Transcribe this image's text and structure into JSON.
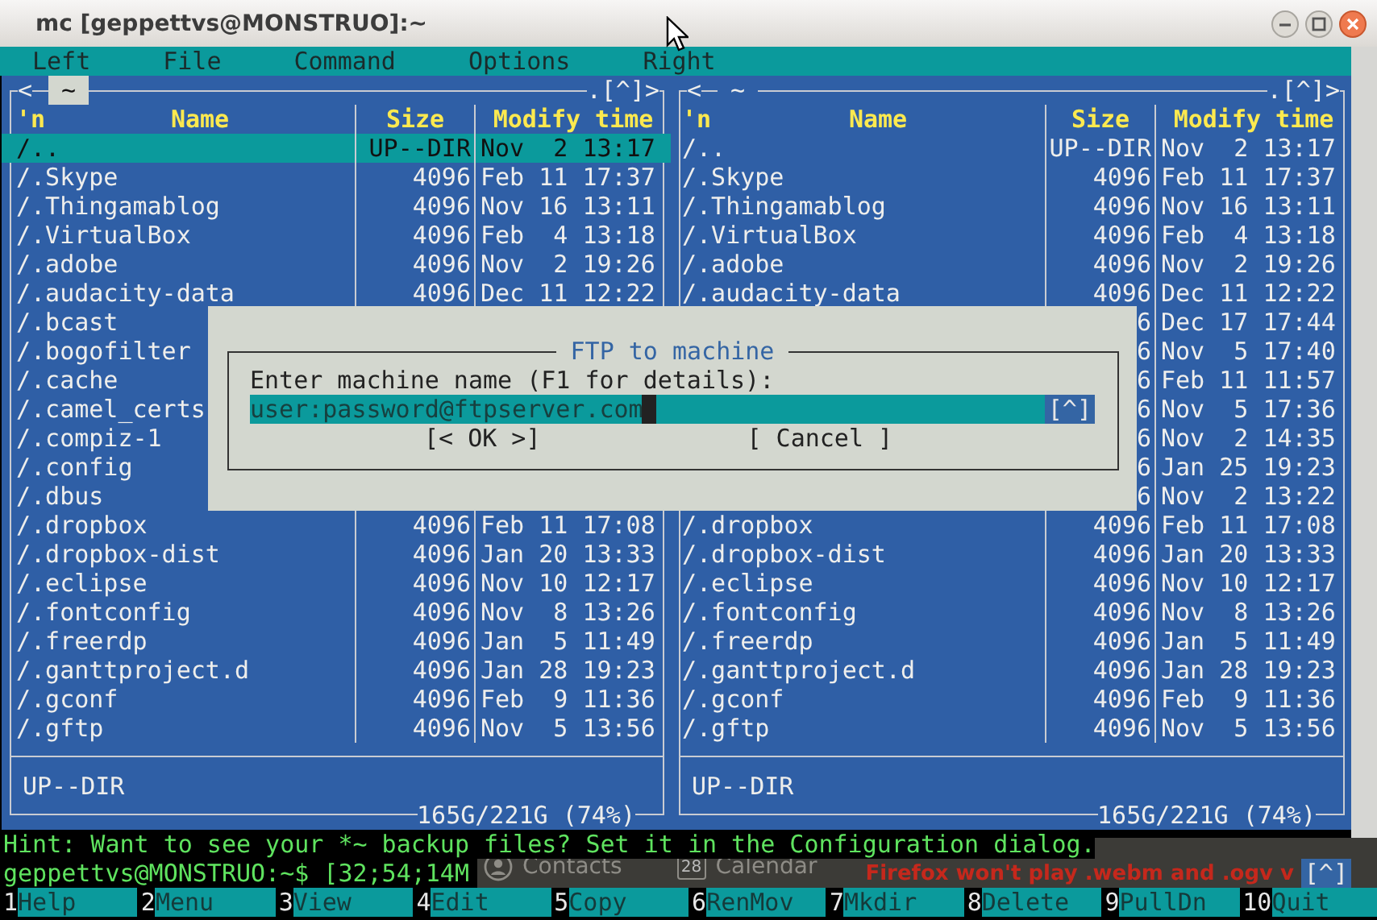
{
  "window": {
    "title": "mc [geppettvs@MONSTRUO]:~"
  },
  "menu_bar": [
    "Left",
    "File",
    "Command",
    "Options",
    "Right"
  ],
  "panels": [
    {
      "active": true,
      "left_marker": "<",
      "path": "~",
      "right_marker": ".[^]>",
      "sort_indicator": "'n",
      "columns": [
        "Name",
        "Size",
        "Modify time"
      ],
      "rows": [
        {
          "name": "/..",
          "size": "UP--DIR",
          "modified": "Nov  2 13:17",
          "selected": true
        },
        {
          "name": "/.Skype",
          "size": "4096",
          "modified": "Feb 11 17:37",
          "selected": false
        },
        {
          "name": "/.Thingamablog",
          "size": "4096",
          "modified": "Nov 16 13:11",
          "selected": false
        },
        {
          "name": "/.VirtualBox",
          "size": "4096",
          "modified": "Feb  4 13:18",
          "selected": false
        },
        {
          "name": "/.adobe",
          "size": "4096",
          "modified": "Nov  2 19:26",
          "selected": false
        },
        {
          "name": "/.audacity-data",
          "size": "4096",
          "modified": "Dec 11 12:22",
          "selected": false
        },
        {
          "name": "/.bcast",
          "selected": false
        },
        {
          "name": "/.bogofilter",
          "selected": false
        },
        {
          "name": "/.cache",
          "selected": false
        },
        {
          "name": "/.camel_certs",
          "selected": false
        },
        {
          "name": "/.compiz-1",
          "selected": false
        },
        {
          "name": "/.config",
          "selected": false
        },
        {
          "name": "/.dbus",
          "selected": false
        },
        {
          "name": "/.dropbox",
          "size": "4096",
          "modified": "Feb 11 17:08",
          "selected": false
        },
        {
          "name": "/.dropbox-dist",
          "size": "4096",
          "modified": "Jan 20 13:33",
          "selected": false
        },
        {
          "name": "/.eclipse",
          "size": "4096",
          "modified": "Nov 10 12:17",
          "selected": false
        },
        {
          "name": "/.fontconfig",
          "size": "4096",
          "modified": "Nov  8 13:26",
          "selected": false
        },
        {
          "name": "/.freerdp",
          "size": "4096",
          "modified": "Jan  5 11:49",
          "selected": false
        },
        {
          "name": "/.ganttproject.d",
          "size": "4096",
          "modified": "Jan 28 19:23",
          "selected": false
        },
        {
          "name": "/.gconf",
          "size": "4096",
          "modified": "Feb  9 11:36",
          "selected": false
        },
        {
          "name": "/.gftp",
          "size": "4096",
          "modified": "Nov  5 13:56",
          "selected": false
        }
      ],
      "mini_status": "UP--DIR",
      "disk_usage": "165G/221G (74%)"
    },
    {
      "active": false,
      "left_marker": "<",
      "path": "~",
      "right_marker": ".[^]>",
      "sort_indicator": "'n",
      "columns": [
        "Name",
        "Size",
        "Modify time"
      ],
      "rows": [
        {
          "name": "/..",
          "size": "UP--DIR",
          "modified": "Nov  2 13:17",
          "selected": false
        },
        {
          "name": "/.Skype",
          "size": "4096",
          "modified": "Feb 11 17:37",
          "selected": false
        },
        {
          "name": "/.Thingamablog",
          "size": "4096",
          "modified": "Nov 16 13:11",
          "selected": false
        },
        {
          "name": "/.VirtualBox",
          "size": "4096",
          "modified": "Feb  4 13:18",
          "selected": false
        },
        {
          "name": "/.adobe",
          "size": "4096",
          "modified": "Nov  2 19:26",
          "selected": false
        },
        {
          "name": "/.audacity-data",
          "size": "4096",
          "modified": "Dec 11 12:22",
          "selected": false
        },
        {
          "size": "6",
          "modified": "Dec 17 17:44",
          "selected": false
        },
        {
          "size": "6",
          "modified": "Nov  5 17:40",
          "selected": false
        },
        {
          "size": "6",
          "modified": "Feb 11 11:57",
          "selected": false
        },
        {
          "size": "6",
          "modified": "Nov  5 17:36",
          "selected": false
        },
        {
          "size": "6",
          "modified": "Nov  2 14:35",
          "selected": false
        },
        {
          "size": "6",
          "modified": "Jan 25 19:23",
          "selected": false
        },
        {
          "size": "6",
          "modified": "Nov  2 13:22",
          "selected": false
        },
        {
          "name": "/.dropbox",
          "size": "4096",
          "modified": "Feb 11 17:08",
          "selected": false
        },
        {
          "name": "/.dropbox-dist",
          "size": "4096",
          "modified": "Jan 20 13:33",
          "selected": false
        },
        {
          "name": "/.eclipse",
          "size": "4096",
          "modified": "Nov 10 12:17",
          "selected": false
        },
        {
          "name": "/.fontconfig",
          "size": "4096",
          "modified": "Nov  8 13:26",
          "selected": false
        },
        {
          "name": "/.freerdp",
          "size": "4096",
          "modified": "Jan  5 11:49",
          "selected": false
        },
        {
          "name": "/.ganttproject.d",
          "size": "4096",
          "modified": "Jan 28 19:23",
          "selected": false
        },
        {
          "name": "/.gconf",
          "size": "4096",
          "modified": "Feb  9 11:36",
          "selected": false
        },
        {
          "name": "/.gftp",
          "size": "4096",
          "modified": "Nov  5 13:56",
          "selected": false
        }
      ],
      "mini_status": "UP--DIR",
      "disk_usage": "165G/221G (74%)"
    }
  ],
  "dialog": {
    "title": "FTP to machine",
    "prompt": "Enter machine name (F1 for details):",
    "value": "user:password@ftpserver.com",
    "history_button": "[^]",
    "buttons": [
      "[< OK >]",
      "[ Cancel ]"
    ]
  },
  "hint": "Hint: Want to see your *~ backup files? Set it in the Configuration dialog.",
  "command_line": {
    "prompt": "geppettvs@MONSTRUO:~$ [32;54;14M",
    "history_button": "[^]"
  },
  "background_glitch": {
    "contacts": "Contacts",
    "calendar_day": "28",
    "calendar": "Calendar",
    "headline": "Firefox won't play .webm and .ogv v"
  },
  "function_keys": [
    {
      "key": "1",
      "label": "Help"
    },
    {
      "key": "2",
      "label": "Menu"
    },
    {
      "key": "3",
      "label": "View"
    },
    {
      "key": "4",
      "label": "Edit"
    },
    {
      "key": "5",
      "label": "Copy"
    },
    {
      "key": "6",
      "label": "RenMov"
    },
    {
      "key": "7",
      "label": "Mkdir"
    },
    {
      "key": "8",
      "label": "Delete"
    },
    {
      "key": "9",
      "label": "PullDn"
    },
    {
      "key": "10",
      "label": "Quit"
    }
  ]
}
